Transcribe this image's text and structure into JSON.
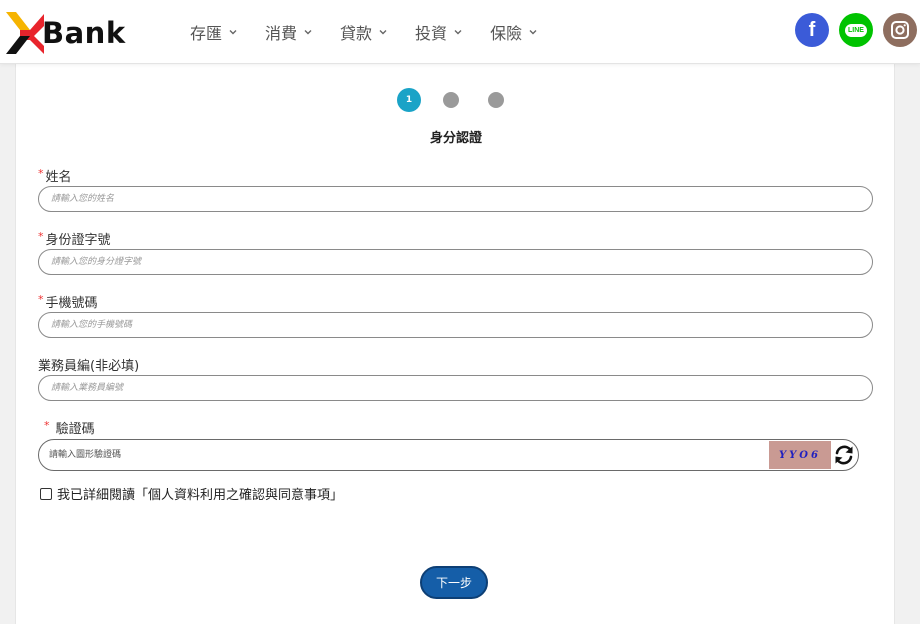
{
  "brand": {
    "name": "Bank"
  },
  "nav": {
    "items": [
      {
        "label": "存匯"
      },
      {
        "label": "消費"
      },
      {
        "label": "貸款"
      },
      {
        "label": "投資"
      },
      {
        "label": "保險"
      }
    ]
  },
  "social": {
    "facebook_glyph": "f",
    "line_label": "LINE",
    "instagram_icon": "instagram-icon"
  },
  "steps": {
    "current_number": "1",
    "title": "身分認證"
  },
  "form": {
    "name": {
      "label": "姓名",
      "placeholder": "請輸入您的姓名",
      "required_mark": "*"
    },
    "id_number": {
      "label": "身份證字號",
      "placeholder": "請輸入您的身分證字號",
      "required_mark": "*"
    },
    "phone": {
      "label": "手機號碼",
      "placeholder": "請輸入您的手機號碼",
      "required_mark": "*"
    },
    "agent": {
      "label": "業務員編(非必填)",
      "placeholder": "請輸入業務員編號"
    },
    "captcha": {
      "label": "驗證碼",
      "placeholder": "請輸入圖形驗證碼",
      "required_mark": "*",
      "image_text": "YYO6"
    },
    "agree_label": "我已詳細閱讀「個人資料利用之確認與同意事項」"
  },
  "actions": {
    "next_label": "下一步"
  },
  "colors": {
    "accent": "#1aa3c7",
    "button": "#155ea8",
    "required": "#ee3333",
    "facebook": "#3b5bd8",
    "line": "#00c300",
    "instagram": "#8e6e5f"
  }
}
